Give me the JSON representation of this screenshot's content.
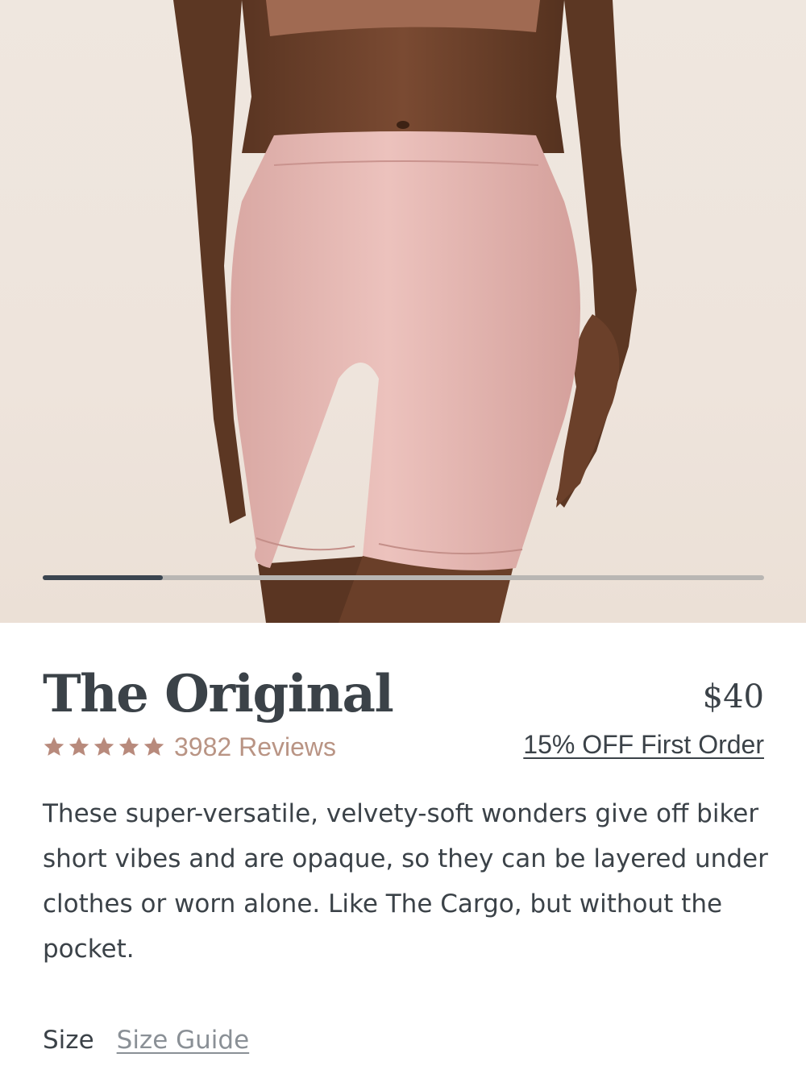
{
  "product": {
    "image_alt": "Model wearing pink biker-style shorts",
    "carousel_progress": 0.167,
    "title": "The Original",
    "price": "$40",
    "rating": 5,
    "reviews_label": "3982 Reviews",
    "promo_label": "15% OFF First Order",
    "description": "These super-versatile, velvety-soft wonders give off biker short vibes and are opaque, so they can be layered under clothes or worn alone. Like The Cargo, but without the pocket.",
    "size_label": "Size",
    "size_guide_label": "Size Guide"
  },
  "colors": {
    "star": "#b88a7c",
    "reviews_text": "#b99484",
    "heading": "#3b4248",
    "progress_fill": "#3b4550",
    "progress_track": "#b9b6b3"
  }
}
